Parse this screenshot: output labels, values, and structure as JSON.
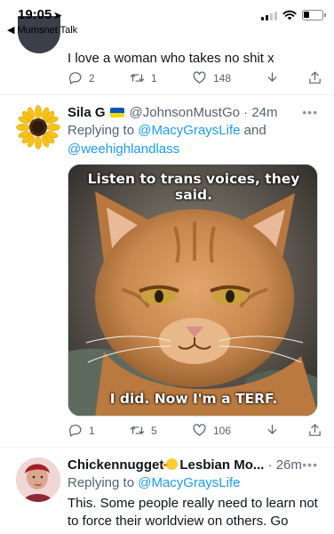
{
  "status_bar": {
    "time": "19:05",
    "back_app": "◀ Mumsnet Talk"
  },
  "tweet1": {
    "text": "I love a woman who takes no shit x",
    "replies": "2",
    "retweets": "1",
    "likes": "148"
  },
  "tweet2": {
    "display_name": "Sila G",
    "handle": "@JohnsonMustGo",
    "time": "24m",
    "replying_to_label": "Replying to",
    "mention1": "@MacyGraysLife",
    "and_label": "and",
    "mention2": "@weehighlandlass",
    "image": {
      "top_caption": "Listen to trans voices, they said.",
      "bottom_caption": "I did. Now I'm a TERF."
    },
    "replies": "1",
    "retweets": "5",
    "likes": "106"
  },
  "tweet3": {
    "display_name_start": "Chickennugget",
    "display_name_end": "Lesbian Mo...",
    "time": "26m",
    "replying_to_label": "Replying to",
    "mention1": "@MacyGraysLife",
    "text": "This. Some people really need to learn not to force their worldview on others. Go"
  },
  "icons": {
    "reply": "reply-icon",
    "retweet": "retweet-icon",
    "like": "heart-icon",
    "share": "share-icon",
    "download": "download-icon"
  },
  "colors": {
    "link": "#1d9bf0",
    "muted": "#536471"
  }
}
